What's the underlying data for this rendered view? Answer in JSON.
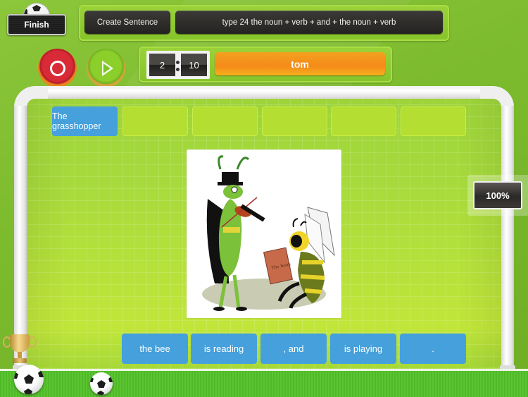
{
  "header": {
    "finish_label": "Finish",
    "mode_label": "Create Sentence",
    "instruction": "type 24 the noun + verb + and + the noun + verb"
  },
  "controls": {
    "record_icon": "record-icon",
    "play_icon": "play-icon"
  },
  "timer": {
    "minutes": "2",
    "seconds": "10"
  },
  "player_name": "tom",
  "answer_slots": [
    {
      "text": "The grasshopper",
      "filled": true
    },
    {
      "text": "",
      "filled": false
    },
    {
      "text": "",
      "filled": false
    },
    {
      "text": "",
      "filled": false
    },
    {
      "text": "",
      "filled": false
    },
    {
      "text": "",
      "filled": false
    }
  ],
  "picture": {
    "description": "Grasshopper in a top hat playing a violin next to a bee reading a book",
    "book_title": "The book"
  },
  "progress": {
    "label": "100%",
    "value_percent": 100
  },
  "word_tiles": [
    {
      "text": "the bee"
    },
    {
      "text": "is reading"
    },
    {
      "text": ", and"
    },
    {
      "text": "is playing"
    },
    {
      "text": "."
    }
  ],
  "colors": {
    "background_green": "#7dbb2e",
    "tile_blue": "#45a0dc",
    "empty_slot_green": "#b5de33",
    "name_bar_orange": "#f48a1a",
    "record_red": "#d82a37",
    "play_green": "#8ccf2b",
    "dark_pill": "#2b2927"
  }
}
